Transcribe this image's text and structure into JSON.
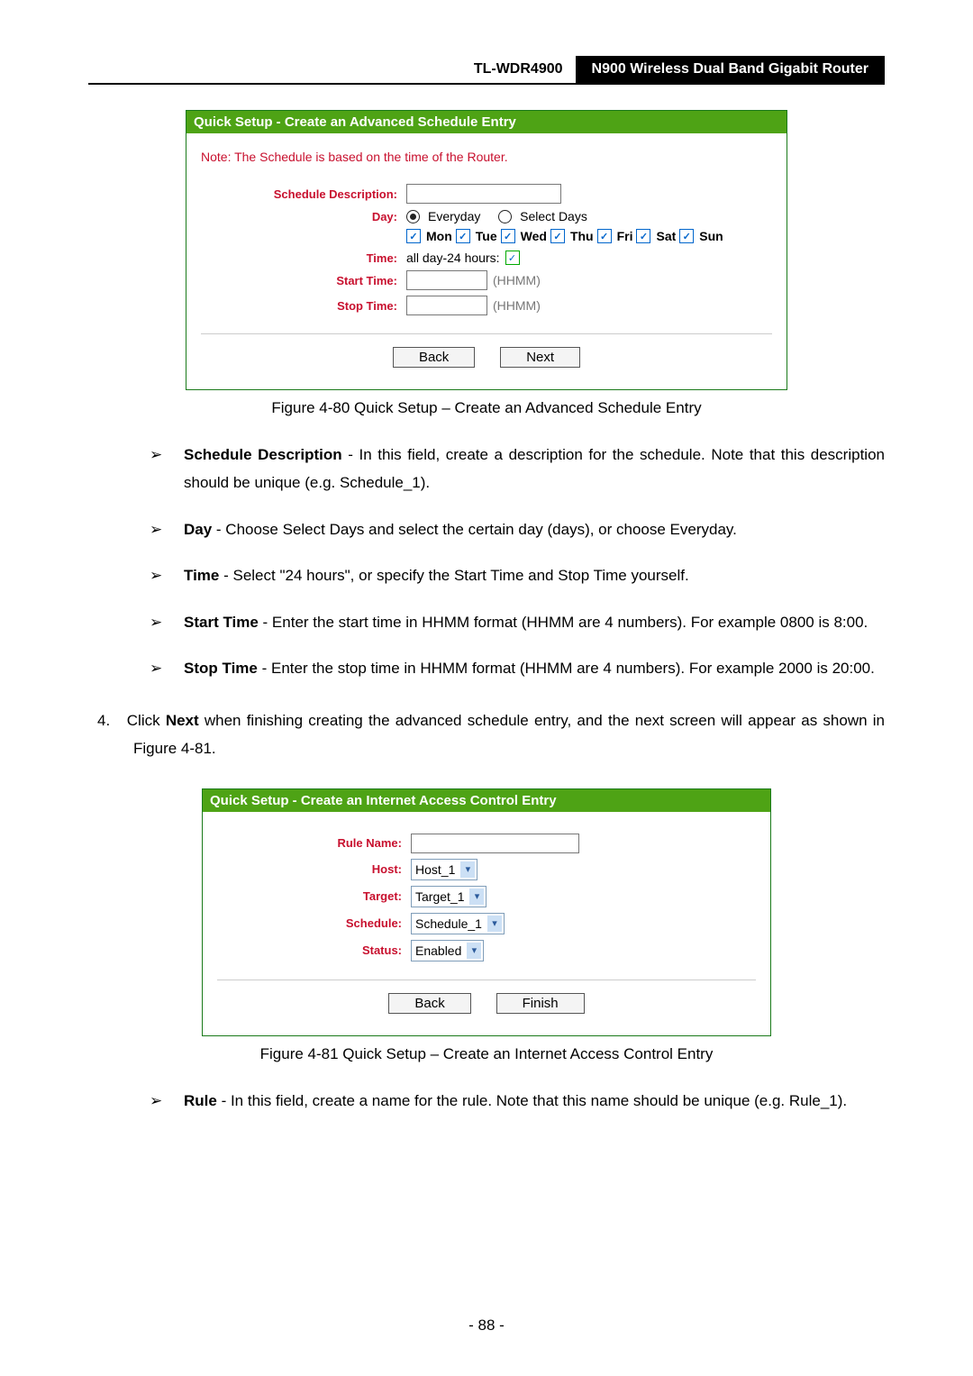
{
  "header": {
    "model": "TL-WDR4900",
    "title": "N900 Wireless Dual Band Gigabit Router"
  },
  "fig1": {
    "box_title": "Quick Setup - Create an Advanced Schedule Entry",
    "note": "Note: The Schedule is based on the time of the Router.",
    "labels": {
      "schedule_description": "Schedule Description:",
      "day": "Day:",
      "time": "Time:",
      "start_time": "Start Time:",
      "stop_time": "Stop Time:"
    },
    "radio_everyday": "Everyday",
    "radio_select_days": "Select Days",
    "days": {
      "mon": "Mon",
      "tue": "Tue",
      "wed": "Wed",
      "thu": "Thu",
      "fri": "Fri",
      "sat": "Sat",
      "sun": "Sun"
    },
    "all_day_label": "all day-24 hours:",
    "hhmm": "(HHMM)",
    "buttons": {
      "back": "Back",
      "next": "Next"
    },
    "caption": "Figure 4-80 Quick Setup – Create an Advanced Schedule Entry"
  },
  "bullets1": {
    "b1_b": "Schedule Description",
    "b1_t": " - In this field, create a description for the schedule. Note that this description should be unique (e.g. Schedule_1).",
    "b2_b": "Day",
    "b2_t": " - Choose Select Days and select the certain day (days), or choose Everyday.",
    "b3_b": "Time",
    "b3_t": " - Select \"24 hours\", or specify the Start Time and Stop Time yourself.",
    "b4_b": "Start Time",
    "b4_t": " - Enter the start time in HHMM format (HHMM are 4 numbers). For example 0800 is 8:00.",
    "b5_b": "Stop Time",
    "b5_t": " - Enter the stop time in HHMM format (HHMM are 4 numbers). For example 2000 is 20:00."
  },
  "step4": {
    "num": "4.",
    "pre": "Click ",
    "bold": "Next",
    "post": " when finishing creating the advanced schedule entry, and the next screen will appear as shown in Figure 4-81."
  },
  "fig2": {
    "box_title": "Quick Setup - Create an Internet Access Control Entry",
    "labels": {
      "rule_name": "Rule Name:",
      "host": "Host:",
      "target": "Target:",
      "schedule": "Schedule:",
      "status": "Status:"
    },
    "values": {
      "host": "Host_1",
      "target": "Target_1",
      "schedule": "Schedule_1",
      "status": "Enabled"
    },
    "buttons": {
      "back": "Back",
      "finish": "Finish"
    },
    "caption": "Figure 4-81 Quick Setup – Create an Internet Access Control Entry"
  },
  "bullets2": {
    "b1_b": "Rule",
    "b1_t": " - In this field, create a name for the rule. Note that this name should be unique (e.g. Rule_1)."
  },
  "page_number": "- 88 -"
}
